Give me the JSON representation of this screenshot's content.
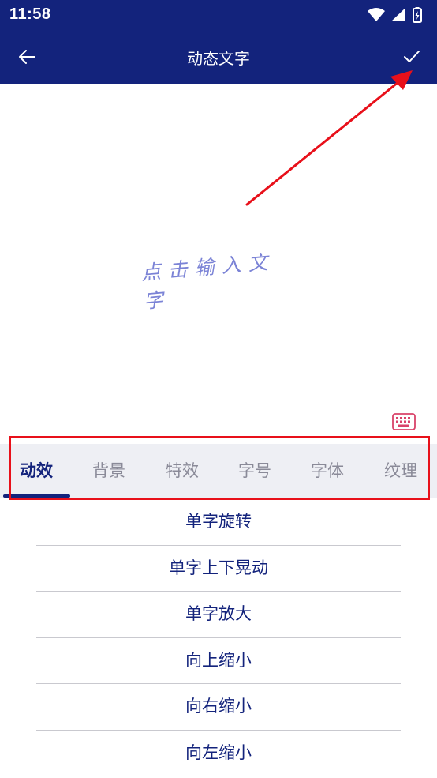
{
  "status_bar": {
    "time": "11:58"
  },
  "app_bar": {
    "title": "动态文字",
    "back_icon": "arrow-left-icon",
    "confirm_icon": "check-icon"
  },
  "canvas": {
    "placeholder": "点击输入文字",
    "keyboard_icon": "keyboard-icon"
  },
  "tabs": [
    {
      "label": "动效",
      "active": true
    },
    {
      "label": "背景",
      "active": false
    },
    {
      "label": "特效",
      "active": false
    },
    {
      "label": "字号",
      "active": false
    },
    {
      "label": "字体",
      "active": false
    },
    {
      "label": "纹理",
      "active": false
    }
  ],
  "effects": [
    {
      "label": "单字旋转"
    },
    {
      "label": "单字上下晃动"
    },
    {
      "label": "单字放大"
    },
    {
      "label": "向上缩小"
    },
    {
      "label": "向右缩小"
    },
    {
      "label": "向左缩小"
    }
  ],
  "colors": {
    "primary": "#13237c",
    "placeholder_text": "#7b83d6",
    "tab_background": "#eeeff4",
    "annotation_red": "#e8101a",
    "keyboard_icon": "#d9436a"
  }
}
